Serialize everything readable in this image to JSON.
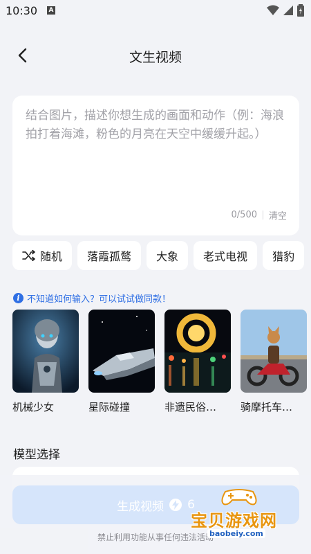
{
  "status_bar": {
    "time": "10:30",
    "notification_badge": "A"
  },
  "header": {
    "title": "文生视频",
    "back_icon": "chevron-left-icon"
  },
  "input": {
    "placeholder": "结合图片，描述你想生成的画面和动作（例：海浪拍打着海滩，粉色的月亮在天空中缓缓升起。）",
    "counter": "0/500",
    "clear_label": "清空"
  },
  "chips": [
    {
      "label": "随机",
      "icon": "shuffle-icon"
    },
    {
      "label": "落霞孤鹜"
    },
    {
      "label": "大象"
    },
    {
      "label": "老式电视"
    },
    {
      "label": "猎豹"
    }
  ],
  "hint": {
    "text": "不知道如何输入？可以试试做同款！",
    "icon": "info-icon"
  },
  "examples": [
    {
      "label": "机械少女"
    },
    {
      "label": "星际碰撞"
    },
    {
      "label": "非遗民俗…"
    },
    {
      "label": "骑摩托车…"
    }
  ],
  "model": {
    "title": "模型选择"
  },
  "generate": {
    "label": "生成视频",
    "cost": "6",
    "icon": "lightning-icon"
  },
  "disclaimer": "禁止利用功能从事任何违法活动",
  "watermark": {
    "text": "宝贝游戏网",
    "url": "baobeiy.com"
  },
  "colors": {
    "accent": "#2f6fe4",
    "button_disabled": "#d6e5fb",
    "background": "#f2f3f7",
    "watermark": "#e8950f"
  }
}
